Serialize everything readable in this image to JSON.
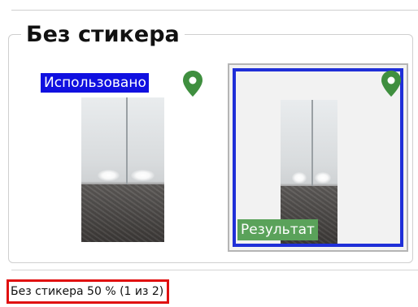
{
  "group": {
    "title": "Без стикера"
  },
  "cards": [
    {
      "badge": "Использовано",
      "badge_color": "#1010e0",
      "icon": "location-pin-icon",
      "selected": false
    },
    {
      "badge": "Результат",
      "badge_color": "#5aa25a",
      "icon": "location-pin-icon",
      "selected": true
    }
  ],
  "colors": {
    "pin": "#3f8f3f",
    "selection_border": "#1f2fd8",
    "status_border": "#e01010"
  },
  "status": {
    "text": "Без стикера 50 % (1 из 2)"
  }
}
